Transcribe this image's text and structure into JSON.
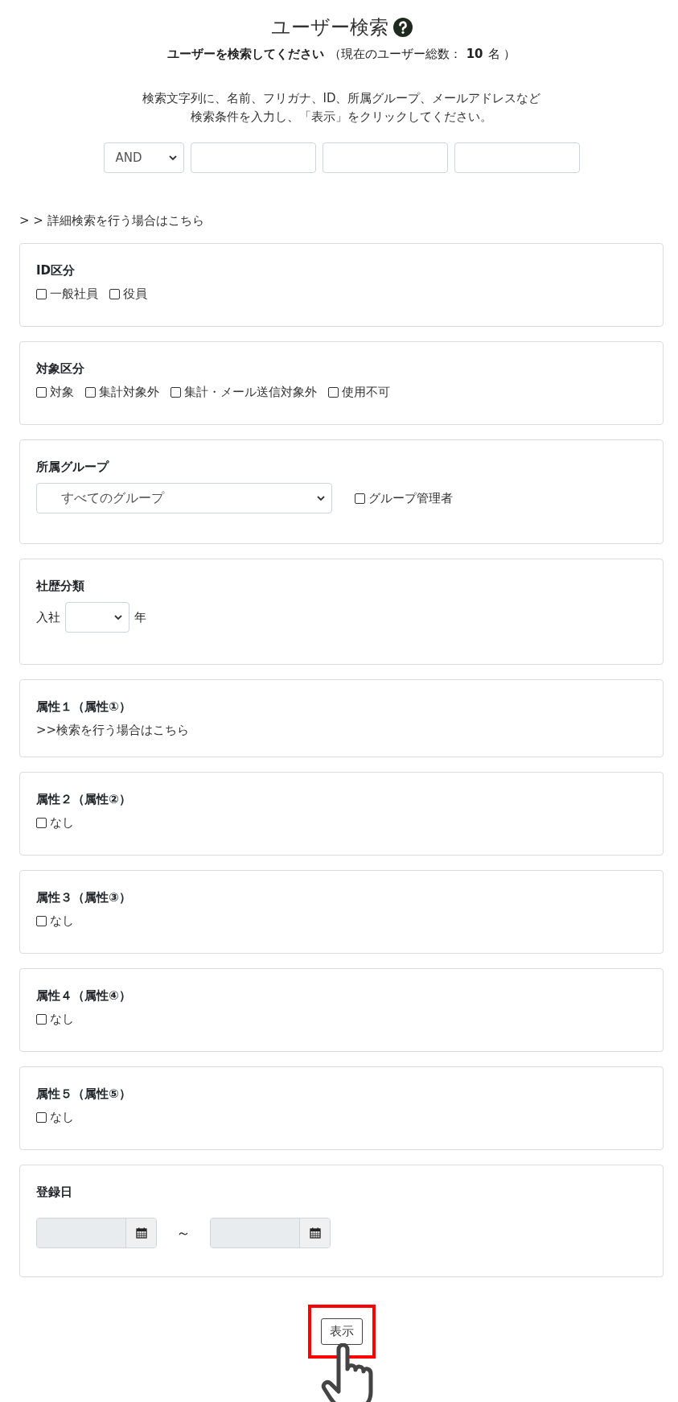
{
  "header": {
    "title": "ユーザー検索",
    "subtitle": "ユーザーを検索してください",
    "count_prefix": "（現在のユーザー総数：",
    "count": "10",
    "count_suffix": "名 ）",
    "description": [
      "検索文字列に、名前、フリガナ、ID、所属グループ、メールアドレスなど",
      "検索条件を入力し、「表示」をクリックしてください。"
    ]
  },
  "search": {
    "operator": "AND",
    "fields": [
      {
        "kind": "text"
      },
      {
        "kind": "text"
      },
      {
        "kind": "text"
      }
    ]
  },
  "advanced_link": "> > 詳細検索を行う場合はこちら",
  "sections": [
    {
      "kind": "checkboxes",
      "title": "ID区分",
      "options": [
        {
          "label": "一般社員",
          "checked": false
        },
        {
          "label": "役員",
          "checked": false
        }
      ]
    },
    {
      "kind": "checkboxes",
      "title": "対象区分",
      "options": [
        {
          "label": "対象",
          "checked": false
        },
        {
          "label": "集計対象外",
          "checked": false
        },
        {
          "label": "集計・メール送信対象外",
          "checked": false
        },
        {
          "label": "使用不可",
          "checked": false
        }
      ]
    },
    {
      "kind": "group",
      "title": "所属グループ",
      "select": "すべてのグループ",
      "options": [
        {
          "label": "グループ管理者",
          "checked": false
        }
      ]
    },
    {
      "kind": "year",
      "title": "社歴分類",
      "before": "入社",
      "after": "年"
    },
    {
      "kind": "link",
      "title": "属性１（属性①）",
      "link": ">>検索を行う場合はこちら"
    },
    {
      "kind": "checkboxes",
      "title": "属性２（属性②）",
      "options": [
        {
          "label": "なし",
          "checked": false
        }
      ]
    },
    {
      "kind": "checkboxes",
      "title": "属性３（属性③）",
      "options": [
        {
          "label": "なし",
          "checked": false
        }
      ]
    },
    {
      "kind": "checkboxes",
      "title": "属性４（属性④）",
      "options": [
        {
          "label": "なし",
          "checked": false
        }
      ]
    },
    {
      "kind": "checkboxes",
      "title": "属性５（属性⑤）",
      "options": [
        {
          "label": "なし",
          "checked": false
        }
      ]
    },
    {
      "kind": "dates",
      "title": "登録日",
      "separator": "～"
    }
  ],
  "submit": {
    "label": "表示",
    "highlighted": true
  }
}
